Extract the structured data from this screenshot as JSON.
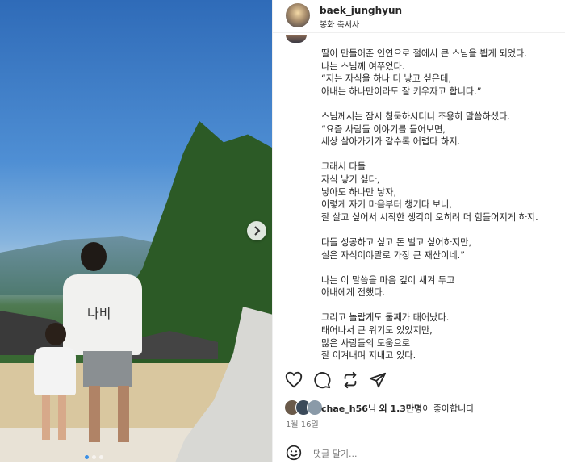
{
  "post": {
    "username": "baek_junghyun",
    "location": "봉화 축서사",
    "caption": "딸이 만들어준 인연으로 절에서 큰 스님을 뵙게 되었다.\n나는 스님께 여쭈었다.\n“저는 자식을 하나 더 낳고 싶은데,\n아내는 하나만이라도 잘 키우자고 합니다.”\n\n스님께서는 잠시 침묵하시더니 조용히 말씀하셨다.\n“요즘 사람들 이야기를 들어보면,\n세상 살아가기가 갈수록 어렵다 하지.\n\n그래서 다들\n자식 낳기 싫다,\n낳아도 하나만 낳자,\n이렇게 자기 마음부터 챙기다 보니,\n잘 살고 싶어서 시작한 생각이 오히려 더 힘들어지게 하지.\n\n다들 성공하고 싶고 돈 벌고 싶어하지만,\n실은 자식이야말로 가장 큰 재산이네.”\n\n나는 이 말씀을 마음 깊이 새겨 두고\n아내에게 전했다.\n\n그리고 놀랍게도 둘째가 태어났다.\n태어나서 큰 위기도 있었지만,\n많은 사람들의 도움으로\n잘 이겨내며 지내고 있다.",
    "likes": {
      "user": "chae_h56",
      "suffix_1": "님 ",
      "others": "외 1.3만명",
      "suffix_2": "이 좋아합니다"
    },
    "date": "1월 16일",
    "comment_placeholder": "댓글 달기...",
    "shirt_text": "나비",
    "carousel": {
      "total": 3,
      "active": 1
    }
  },
  "icons": {
    "like": "heart-icon",
    "comment": "comment-icon",
    "repost": "repost-icon",
    "share": "send-icon",
    "next": "chevron-right-icon",
    "emoji": "emoji-icon"
  },
  "colors": {
    "text": "#262626",
    "muted": "#737373",
    "border": "#efefef",
    "carousel_active": "#3a8fe6"
  }
}
